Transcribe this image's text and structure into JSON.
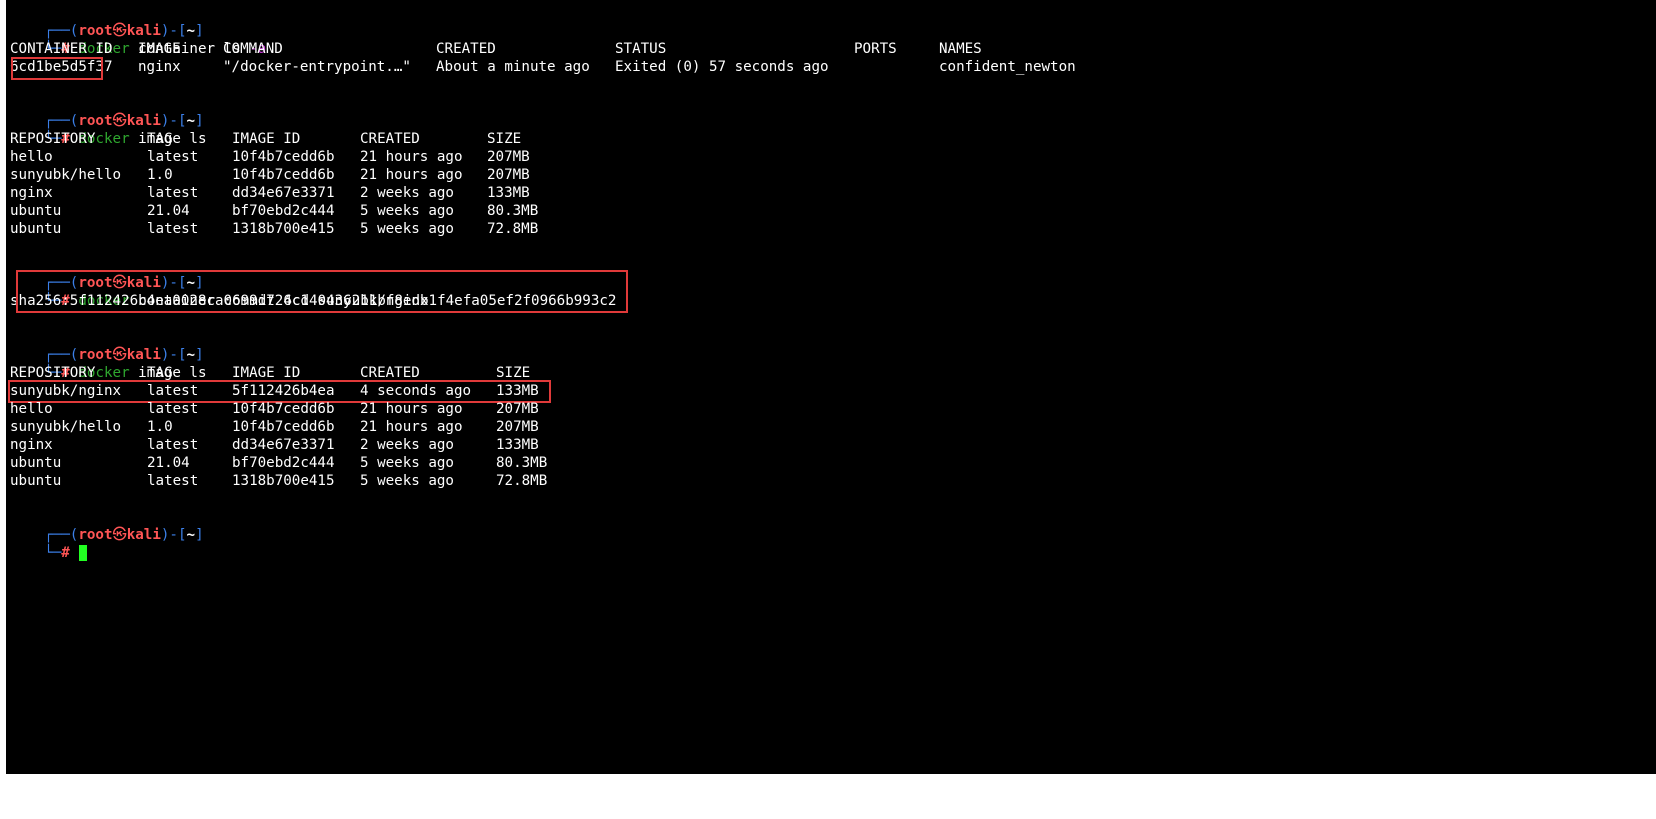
{
  "prompt": {
    "open": "┌──(",
    "user": "root",
    "at": "㉿",
    "host": "kali",
    "mid": ")-[",
    "dir": "~",
    "close": "]",
    "arrow": "└─",
    "hash": "#"
  },
  "cmd1": {
    "docker": "docker",
    "args": " container ls ",
    "flag": "-a"
  },
  "containers": {
    "headers": [
      "CONTAINER ID",
      "IMAGE",
      "COMMAND",
      "CREATED",
      "STATUS",
      "PORTS",
      "NAMES"
    ],
    "rows": [
      [
        "6cd1be5d5f37",
        "nginx",
        "\"/docker-entrypoint.…\"",
        "About a minute ago",
        "Exited (0) 57 seconds ago",
        "",
        "confident_newton"
      ]
    ]
  },
  "cmd2": {
    "docker": "docker",
    "args": " image ls"
  },
  "images1": {
    "headers": [
      "REPOSITORY",
      "TAG",
      "IMAGE ID",
      "CREATED",
      "SIZE"
    ],
    "rows": [
      [
        "hello",
        "latest",
        "10f4b7cedd6b",
        "21 hours ago",
        "207MB"
      ],
      [
        "sunyubk/hello",
        "1.0",
        "10f4b7cedd6b",
        "21 hours ago",
        "207MB"
      ],
      [
        "nginx",
        "latest",
        "dd34e67e3371",
        "2 weeks ago",
        "133MB"
      ],
      [
        "ubuntu",
        "21.04",
        "bf70ebd2c444",
        "5 weeks ago",
        "80.3MB"
      ],
      [
        "ubuntu",
        "latest",
        "1318b700e415",
        "5 weeks ago",
        "72.8MB"
      ]
    ]
  },
  "cmd3": {
    "docker": "docker",
    "args": " container commit 6cd sunyubk/nginx"
  },
  "commit_output": "sha256:5f112426b4ea0028ca0699d724c140436211bf8edb1f4efa05ef2f0966b993c2",
  "cmd4": {
    "docker": "docker",
    "args": " image ls"
  },
  "images2": {
    "headers": [
      "REPOSITORY",
      "TAG",
      "IMAGE ID",
      "CREATED",
      "SIZE"
    ],
    "rows": [
      [
        "sunyubk/nginx",
        "latest",
        "5f112426b4ea",
        "4 seconds ago",
        "133MB"
      ],
      [
        "hello",
        "latest",
        "10f4b7cedd6b",
        "21 hours ago",
        "207MB"
      ],
      [
        "sunyubk/hello",
        "1.0",
        "10f4b7cedd6b",
        "21 hours ago",
        "207MB"
      ],
      [
        "nginx",
        "latest",
        "dd34e67e3371",
        "2 weeks ago",
        "133MB"
      ],
      [
        "ubuntu",
        "21.04",
        "bf70ebd2c444",
        "5 weeks ago",
        "80.3MB"
      ],
      [
        "ubuntu",
        "latest",
        "1318b700e415",
        "5 weeks ago",
        "72.8MB"
      ]
    ]
  },
  "colors": {
    "background": "#000000",
    "prompt_frame": "#3b7fe8",
    "prompt_user": "#ff5555",
    "command": "#2fa72f",
    "flag": "#c53ad6",
    "cursor": "#22ff22",
    "highlight_box": "#e03a3a"
  }
}
